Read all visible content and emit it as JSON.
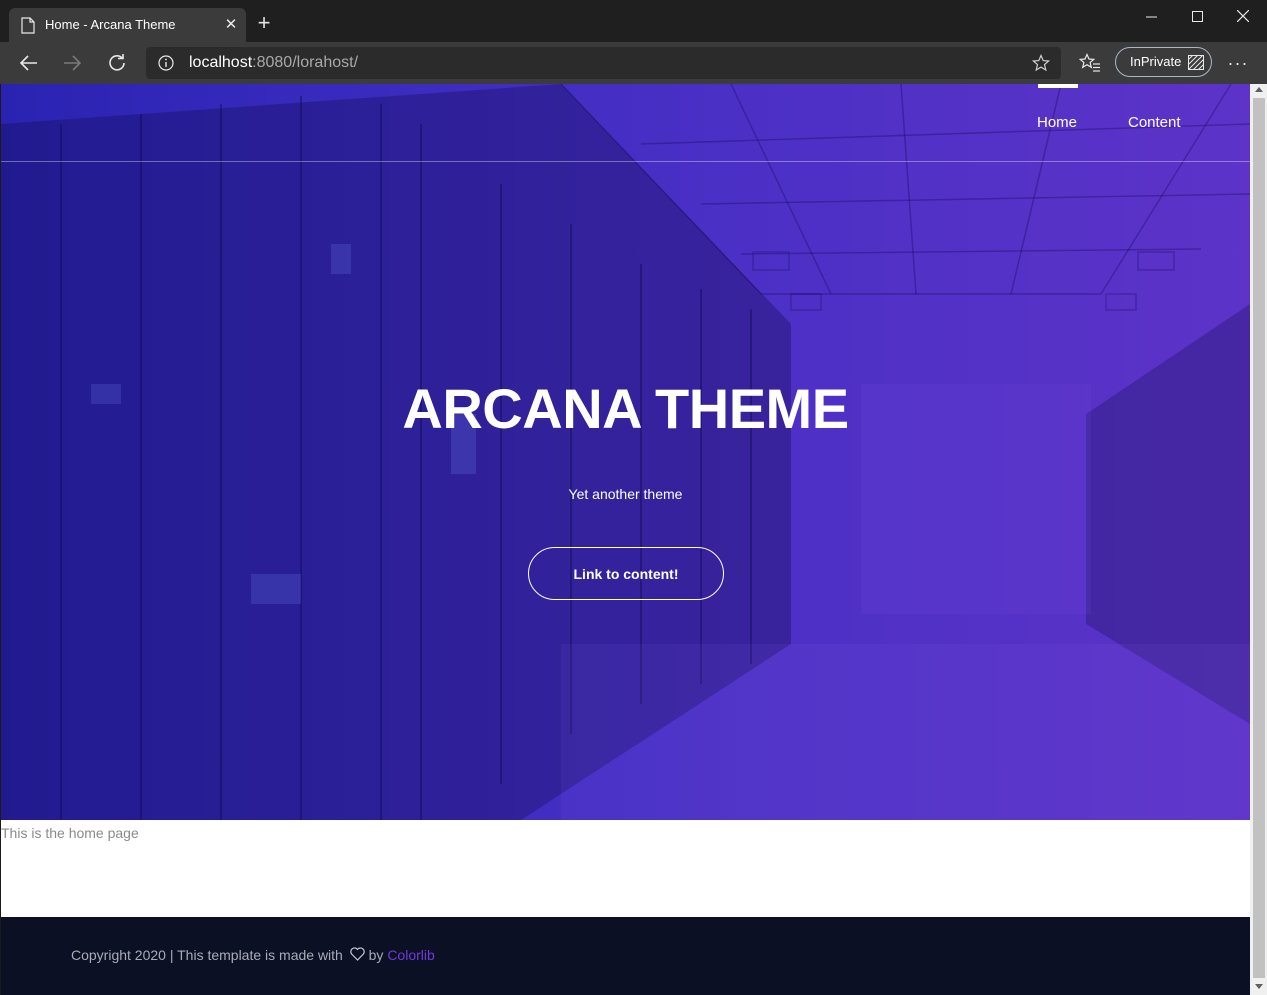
{
  "browser": {
    "tab_title": "Home - Arcana Theme",
    "url_host": "localhost",
    "url_rest": ":8080/lorahost/",
    "inprivate_label": "InPrivate"
  },
  "nav": {
    "items": [
      {
        "label": "Home",
        "active": true
      },
      {
        "label": "Content",
        "active": false
      }
    ]
  },
  "hero": {
    "title": "ARCANA THEME",
    "subtitle": "Yet another theme",
    "button_label": "Link to content!",
    "overlay_colors": [
      "#2a23b2",
      "#5d33c8"
    ]
  },
  "content": {
    "text": "This is the home page"
  },
  "footer": {
    "text_before": "Copyright 2020 | This template is made with ",
    "text_by": " by ",
    "link_label": "Colorlib",
    "link_color": "#6f3ad8"
  }
}
